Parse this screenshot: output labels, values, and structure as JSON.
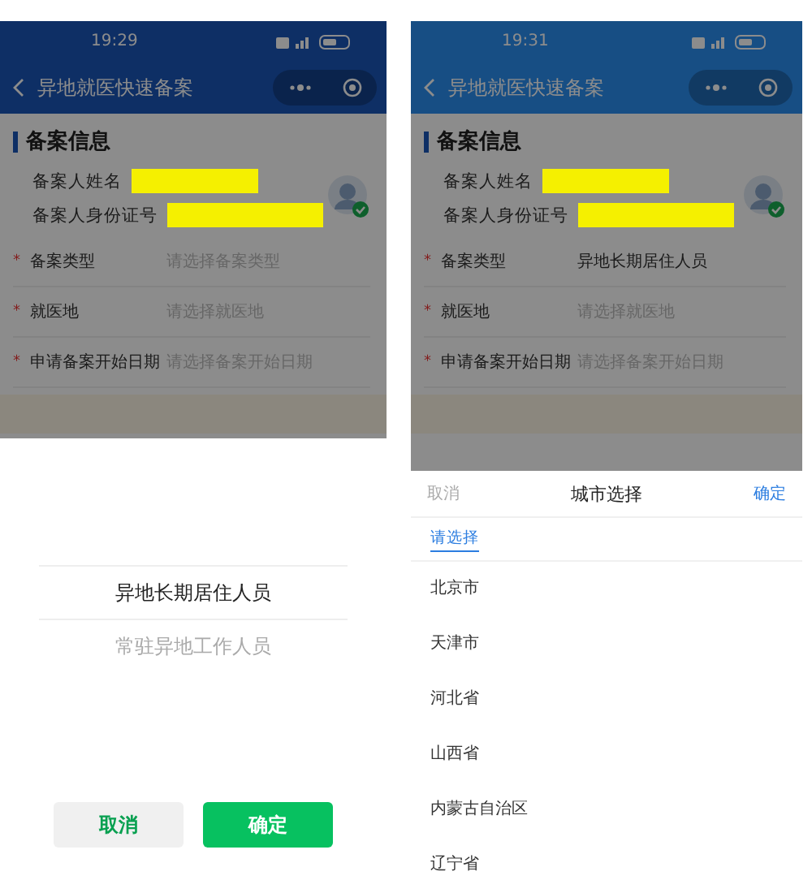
{
  "phones": [
    {
      "kind": "dark",
      "status_time": "19:29",
      "title": "异地就医快速备案",
      "section": "备案信息",
      "name_label": "备案人姓名",
      "id_label": "备案人身份证号",
      "fields": [
        {
          "required_mark": "*",
          "label": "备案类型",
          "placeholder": "请选择备案类型"
        },
        {
          "required_mark": "*",
          "label": "就医地",
          "placeholder": "请选择就医地"
        },
        {
          "required_mark": "*",
          "label": "申请备案开始日期",
          "placeholder": "请选择备案开始日期"
        }
      ],
      "sheet": {
        "kind": "picker",
        "options": [
          {
            "label": "异地长期居住人员",
            "selected": true
          },
          {
            "label": "常驻异地工作人员",
            "selected": false
          }
        ],
        "cancel": "取消",
        "confirm": "确定"
      }
    },
    {
      "kind": "light",
      "status_time": "19:31",
      "title": "异地就医快速备案",
      "section": "备案信息",
      "name_label": "备案人姓名",
      "id_label": "备案人身份证号",
      "fields": [
        {
          "required_mark": "*",
          "label": "备案类型",
          "value": "异地长期居住人员"
        },
        {
          "required_mark": "*",
          "label": "就医地",
          "placeholder": "请选择就医地"
        },
        {
          "required_mark": "*",
          "label": "申请备案开始日期",
          "placeholder": "请选择备案开始日期"
        }
      ],
      "sheet": {
        "kind": "city",
        "cancel": "取消",
        "title": "城市选择",
        "confirm": "确定",
        "tab": "请选择",
        "cities": [
          "北京市",
          "天津市",
          "河北省",
          "山西省",
          "内蒙古自治区",
          "辽宁省"
        ]
      }
    }
  ]
}
